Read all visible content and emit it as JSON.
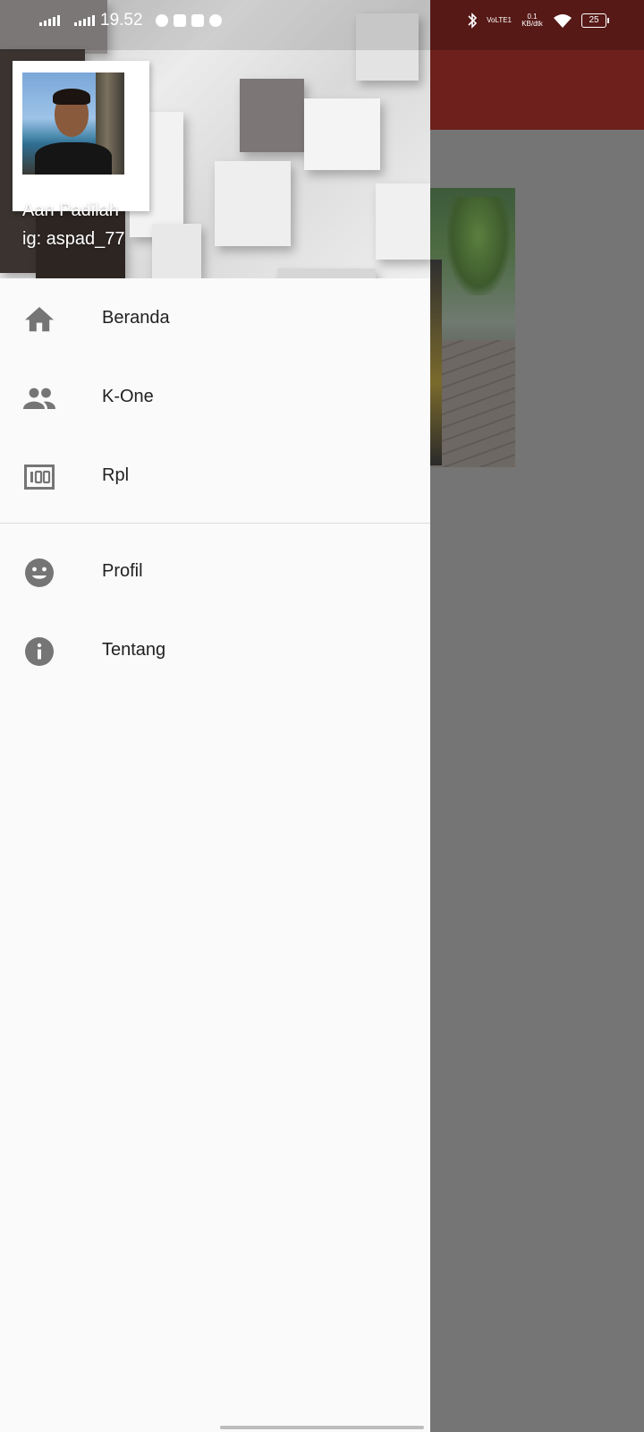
{
  "status_bar": {
    "time": "19.52",
    "net_1": "VoLTE1",
    "net_2": "0.1 KB/dtk",
    "battery": "25"
  },
  "drawer": {
    "header": {
      "name": "Aan Padilah",
      "subtitle": "ig: aspad_77"
    },
    "primary_items": [
      {
        "label": "Beranda",
        "icon": "home-icon"
      },
      {
        "label": "K-One",
        "icon": "people-icon"
      },
      {
        "label": "Rpl",
        "icon": "hundred-icon"
      }
    ],
    "secondary_items": [
      {
        "label": "Profil",
        "icon": "smiley-icon"
      },
      {
        "label": "Tentang",
        "icon": "info-icon"
      }
    ]
  },
  "colors": {
    "app_bar": "#6e201c",
    "scrim": "#757575",
    "drawer_bg": "#fafafa",
    "icon": "#757575",
    "text": "#212121"
  }
}
